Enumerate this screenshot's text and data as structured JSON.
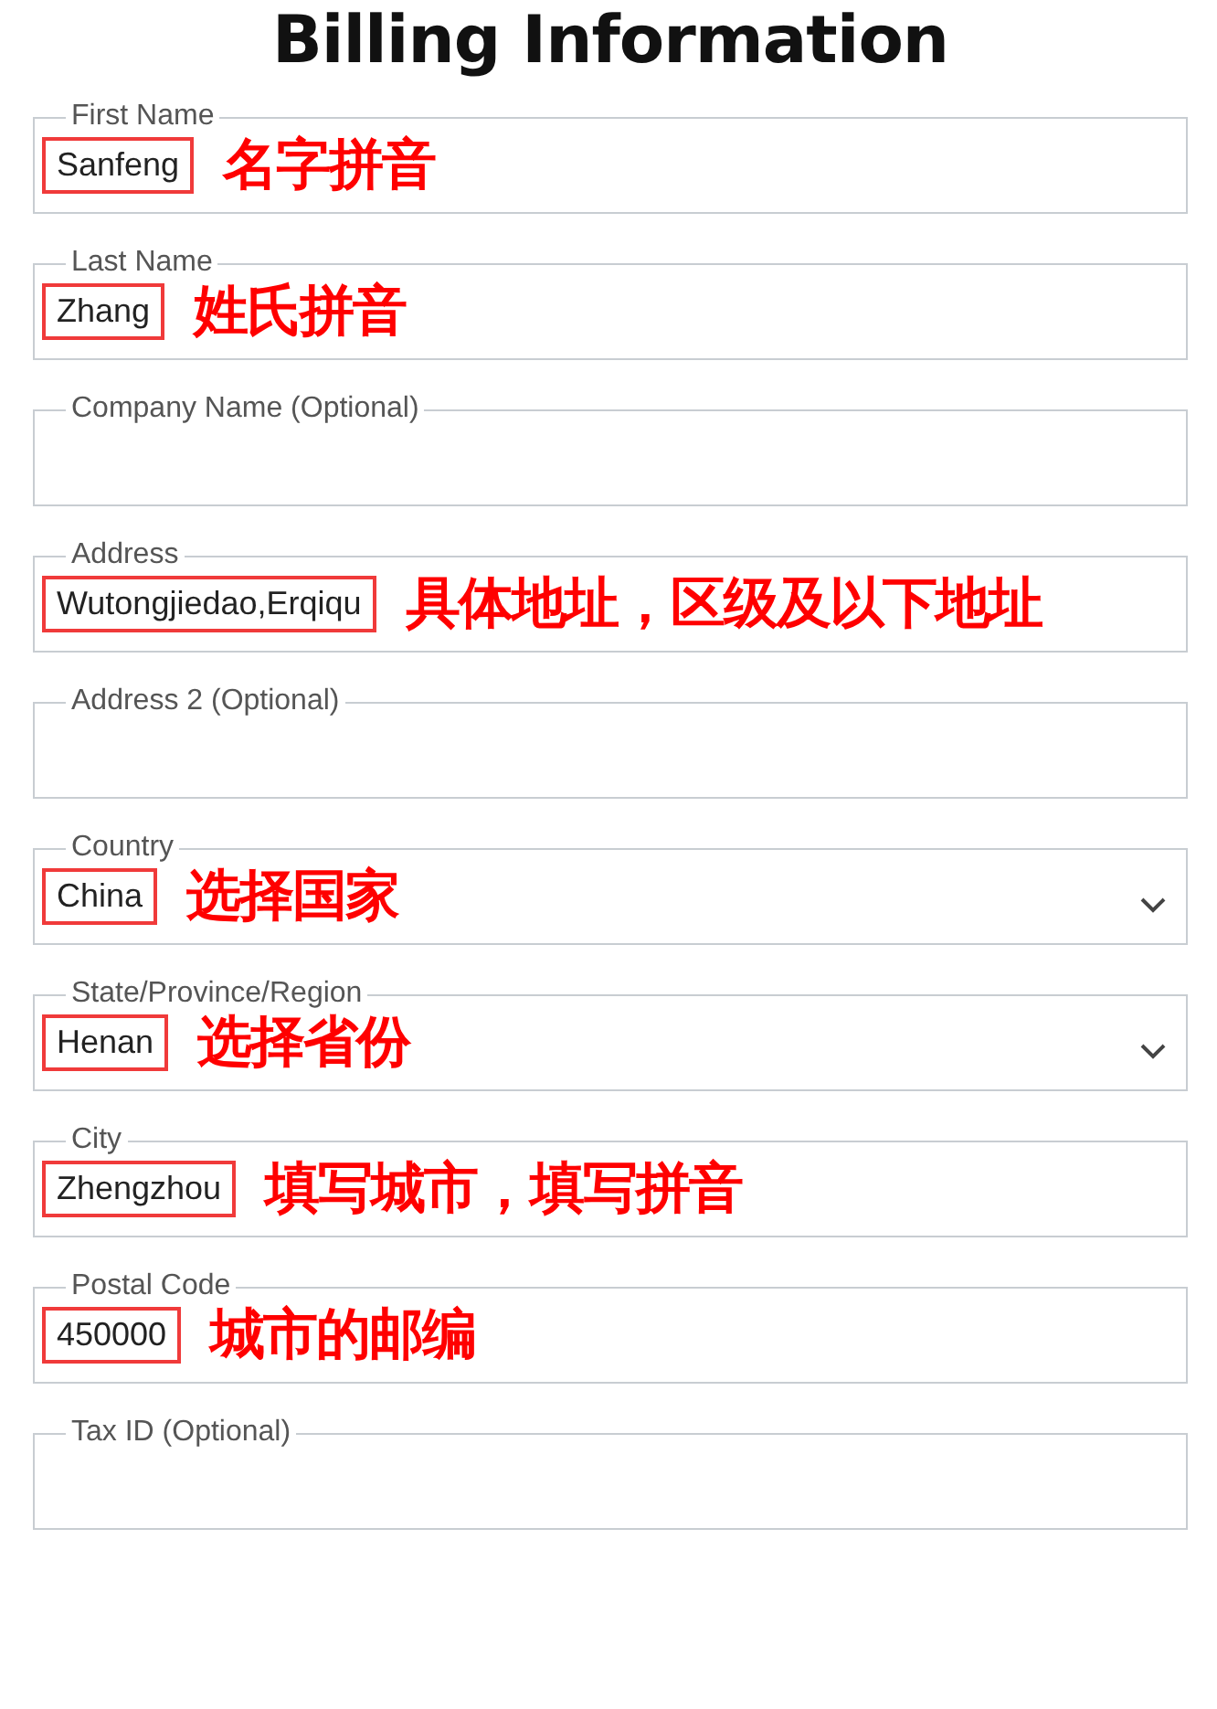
{
  "title": "Billing Information",
  "fields": [
    {
      "label": "First Name",
      "kind": "text",
      "value": "Sanfeng",
      "note": "名字拼音"
    },
    {
      "label": "Last Name",
      "kind": "text",
      "value": "Zhang",
      "note": "姓氏拼音"
    },
    {
      "label": "Company Name (Optional)",
      "kind": "text"
    },
    {
      "label": "Address",
      "kind": "text",
      "value": "Wutongjiedao,Erqiqu",
      "note": "具体地址，区级及以下地址"
    },
    {
      "label": "Address 2 (Optional)",
      "kind": "text"
    },
    {
      "label": "Country",
      "kind": "select",
      "value": "China",
      "note": "选择国家"
    },
    {
      "label": "State/Province/Region",
      "kind": "select",
      "value": "Henan",
      "note": "选择省份"
    },
    {
      "label": "City",
      "kind": "text",
      "value": "Zhengzhou",
      "note": "填写城市，填写拼音"
    },
    {
      "label": "Postal Code",
      "kind": "text",
      "value": "450000",
      "note": "城市的邮编"
    },
    {
      "label": "Tax ID (Optional)",
      "kind": "text"
    }
  ]
}
